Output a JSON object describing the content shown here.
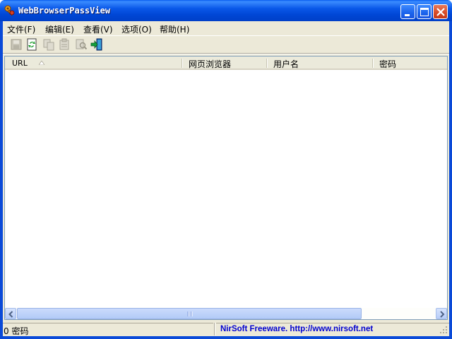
{
  "window": {
    "title": "WebBrowserPassView"
  },
  "menu": {
    "items": [
      {
        "label": "文件(F)"
      },
      {
        "label": "编辑(E)"
      },
      {
        "label": "查看(V)"
      },
      {
        "label": "选项(O)"
      },
      {
        "label": "帮助(H)"
      }
    ]
  },
  "toolbar": {
    "buttons": [
      {
        "icon": "save-icon",
        "enabled": false
      },
      {
        "icon": "refresh-icon",
        "enabled": true
      },
      {
        "icon": "copy-icon",
        "enabled": false
      },
      {
        "icon": "properties-icon",
        "enabled": false
      },
      {
        "icon": "find-icon",
        "enabled": false
      },
      {
        "icon": "exit-icon",
        "enabled": true
      }
    ]
  },
  "list": {
    "columns": [
      {
        "label": "URL",
        "sorted": "ascending"
      },
      {
        "label": "网页浏览器"
      },
      {
        "label": "用户名"
      },
      {
        "label": "密码"
      }
    ],
    "rows": []
  },
  "status": {
    "count_text": "0 密码",
    "credit_text": "NirSoft Freeware.  http://www.nirsoft.net"
  },
  "colors": {
    "title_bar": "#0a58e8",
    "face": "#ece9d8",
    "credit_link": "#0000d0"
  }
}
